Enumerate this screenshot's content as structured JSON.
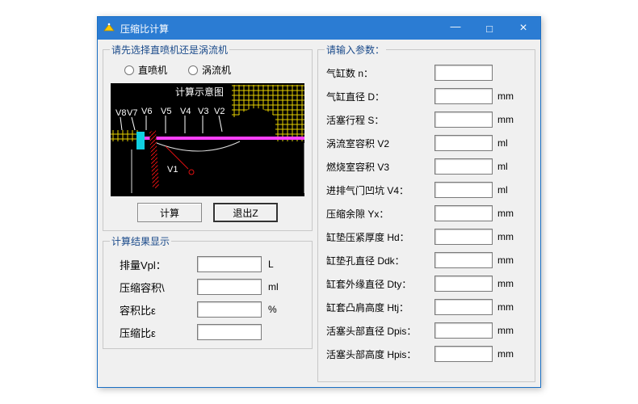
{
  "window": {
    "title": "压缩比计算"
  },
  "titlebar": {
    "min_tip": "—",
    "max_tip": "□",
    "close_tip": "×"
  },
  "engine_select": {
    "legend": "请先选择直喷机还是涡流机",
    "opt1": "直喷机",
    "opt2": "涡流机"
  },
  "diagram": {
    "title": "计算示意图",
    "labels": [
      "V8",
      "V7",
      "V6",
      "V5",
      "V4",
      "V3",
      "V2",
      "V1"
    ]
  },
  "actions": {
    "calc": "计算",
    "exit": "退出Z"
  },
  "results": {
    "legend": "计算结果显示",
    "rows": [
      {
        "label": "排量Vpl：",
        "unit": "L"
      },
      {
        "label": "压缩容积\\",
        "unit": "ml"
      },
      {
        "label": "容积比ε",
        "unit": "%"
      },
      {
        "label": "压缩比ε",
        "unit": ""
      }
    ]
  },
  "params": {
    "legend": "请输入参数：",
    "rows": [
      {
        "label": "气缸数 n：",
        "unit": ""
      },
      {
        "label": "气缸直径 D：",
        "unit": "mm"
      },
      {
        "label": "活塞行程 S：",
        "unit": "mm"
      },
      {
        "label": "涡流室容积 V2",
        "unit": "ml"
      },
      {
        "label": "燃烧室容积 V3",
        "unit": "ml"
      },
      {
        "label": "进排气门凹坑 V4：",
        "unit": "ml"
      },
      {
        "label": "压缩余隙 Yx：",
        "unit": "mm"
      },
      {
        "label": "缸垫压紧厚度 Hd：",
        "unit": "mm"
      },
      {
        "label": "缸垫孔直径 Ddk：",
        "unit": "mm"
      },
      {
        "label": "缸套外缘直径 Dty：",
        "unit": "mm"
      },
      {
        "label": "缸套凸肩高度 Htj：",
        "unit": "mm"
      },
      {
        "label": "活塞头部直径 Dpis：",
        "unit": "mm"
      },
      {
        "label": "活塞头部高度 Hpis：",
        "unit": "mm"
      }
    ]
  }
}
